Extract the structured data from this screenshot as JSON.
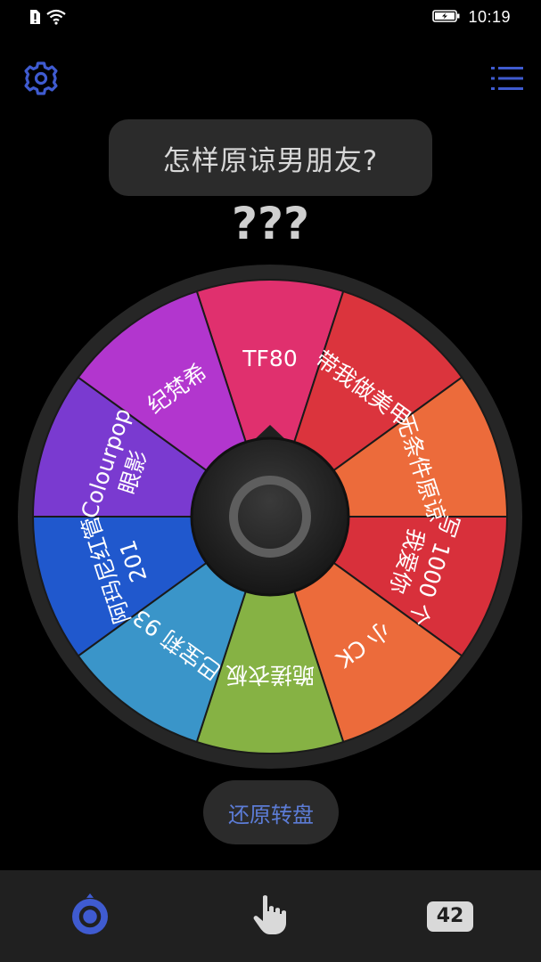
{
  "status_bar": {
    "time": "10:19"
  },
  "header": {
    "settings_icon": "gear-icon",
    "menu_icon": "list-icon",
    "accent_color": "#3f5bd0"
  },
  "question": "怎样原谅男朋友?",
  "result": "???",
  "wheel": {
    "segments": [
      {
        "label": "TF80",
        "color": "#e0306e"
      },
      {
        "label": "带我做美甲",
        "color": "#db343d"
      },
      {
        "label": "无条件原谅",
        "color": "#ec6b3b"
      },
      {
        "label": [
          "写 1000 个",
          "我爱你"
        ],
        "color": "#d8303b"
      },
      {
        "label": "小 CK",
        "color": "#ec6b3b"
      },
      {
        "label": "跪搓衣板",
        "color": "#86b244"
      },
      {
        "label": [
          "巴宝莉 93"
        ],
        "color": "#3a95c9"
      },
      {
        "label": [
          "阿玛尼红管",
          "201"
        ],
        "color": "#2058cd"
      },
      {
        "label": [
          "Colourpop",
          "眼影"
        ],
        "color": "#7a3ad0"
      },
      {
        "label": "纪梵希",
        "color": "#b236ce"
      }
    ]
  },
  "reset_label": "还原转盘",
  "bottom_nav": {
    "wheel_icon": "wheel-icon",
    "tap_icon": "hand-pointer-icon",
    "count": "42"
  }
}
